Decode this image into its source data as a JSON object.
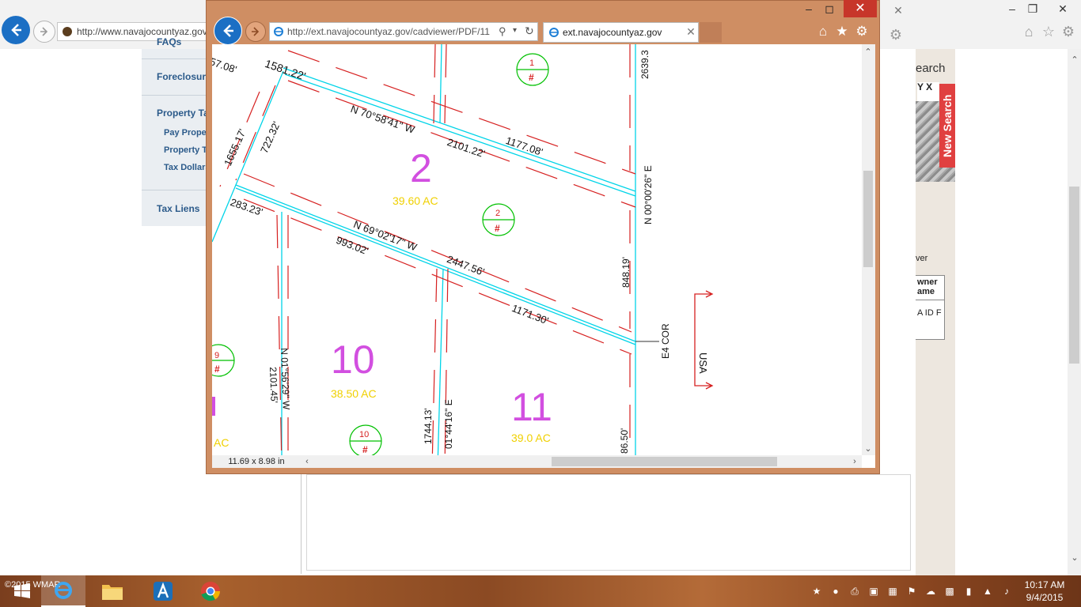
{
  "background_browser": {
    "address": "http://www.navajocountyaz.gov",
    "address_domain": "navajocountyaz.gov"
  },
  "sidebar": {
    "links": [
      {
        "label": "FAQs"
      },
      {
        "label": "Foreclosures"
      },
      {
        "label": "Property Tax"
      }
    ],
    "sub_links": [
      {
        "label": "Pay Property"
      },
      {
        "label": "Property Tax"
      },
      {
        "label": "Tax Dollars"
      }
    ],
    "tax_liens": "Tax Liens"
  },
  "right_panel": {
    "search_header": "earch",
    "new_search": "New Search",
    "yx_label": "Y X",
    "owner_label": "ver",
    "owner_col": "wner ame",
    "owner_val": "A ID F"
  },
  "popup": {
    "address": "http://ext.navajocountyaz.gov/cadviewer/PDF/11",
    "address_domain": "navajocountyaz.gov",
    "tab_title": "ext.navajocountyaz.gov",
    "page_size": "11.69 x 8.98 in"
  },
  "map": {
    "bearings": [
      "1581.22'",
      "N 70°58'41\" W",
      "2101.22'",
      "1177.08'",
      "2639.3",
      "N 00°00'26\" E",
      "1655.17'",
      "722.32'",
      "283.23'",
      "N 69°02'17\" W",
      "993.02'",
      "2447.56'",
      "848.19'",
      "1171.30'",
      "N 01°56'29\" W",
      "2101.45'",
      "1744.13'",
      "01°44'16\" E",
      "86.50'",
      "57.08'",
      "E4 COR",
      "USA"
    ],
    "parcels": [
      {
        "number": "2",
        "acres": "39.60 AC"
      },
      {
        "number": "10",
        "acres": "38.50 AC"
      },
      {
        "number": "11",
        "acres": "39.0 AC"
      },
      {
        "number": "",
        "acres": "AC"
      }
    ],
    "markers": [
      {
        "num": "1",
        "sym": "#"
      },
      {
        "num": "2",
        "sym": "#"
      },
      {
        "num": "9",
        "sym": "#"
      },
      {
        "num": "10",
        "sym": "#"
      }
    ]
  },
  "taskbar": {
    "watermark": "©2015 WMAR",
    "time": "10:17 AM",
    "date": "9/4/2015",
    "apps": [
      "start-icon",
      "internet-explorer-icon",
      "file-explorer-icon",
      "app-a-icon",
      "chrome-icon"
    ]
  },
  "colors": {
    "popup_frame": "#cf8e63",
    "map_line_cyan": "#00d4e8",
    "map_line_red": "#d62020",
    "parcel_magenta": "#d24fe0",
    "acres_yellow": "#f0d000",
    "marker_green": "#00c000"
  }
}
